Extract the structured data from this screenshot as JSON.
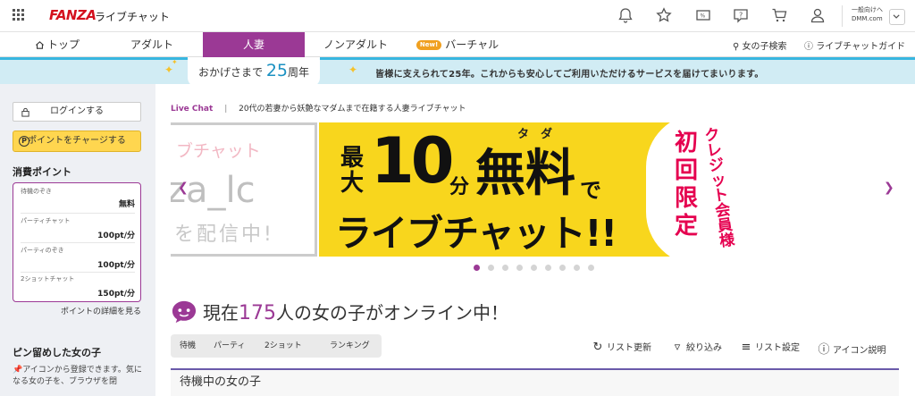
{
  "header": {
    "brand": "FANZA",
    "brand_sub": "ライブチャット",
    "adult_switch": [
      "一般向けへ",
      "DMM.com"
    ]
  },
  "nav": {
    "tabs": [
      {
        "label": "トップ"
      },
      {
        "label": "アダルト"
      },
      {
        "label": "人妻"
      },
      {
        "label": "ノンアダルト"
      },
      {
        "label": "バーチャル",
        "badge": "New!"
      }
    ],
    "right": [
      "女の子検索",
      "ライブチャットガイド"
    ]
  },
  "anniversary": {
    "pre": "おかげさまで",
    "years": "25",
    "post": "周年",
    "message": "皆様に支えられて25年。これからも安心してご利用いただけるサービスを届けてまいります。"
  },
  "sidebar": {
    "login": "ログインする",
    "charge": "ポイントをチャージする",
    "points_title": "消費ポイント",
    "points": [
      {
        "label": "待機のぞき",
        "value": "無料"
      },
      {
        "label": "パーティチャット",
        "value": "100pt/分"
      },
      {
        "label": "パーティのぞき",
        "value": "100pt/分"
      },
      {
        "label": "2ショットチャット",
        "value": "150pt/分"
      }
    ],
    "detail": "ポイントの詳細を見る",
    "pinned_title": "ピン留めした女の子",
    "pinned_note": "アイコンから登録できます。気になる女の子を、ブラウザを閉"
  },
  "main": {
    "breadcrumb_label": "Live Chat",
    "breadcrumb_sep": "|",
    "breadcrumb_desc": "20代の若妻から妖艶なマダムまで在籍する人妻ライブチャット",
    "banner": {
      "prev_lines": [
        "ブチャット",
        "za_lc",
        "を配信中!"
      ],
      "ruby": "タ　ダ",
      "line1_small": "最大",
      "line1_big": "10",
      "line1_unit": "分",
      "line1_word": "無料",
      "line1_de": "で",
      "line2": "ライブチャット!!",
      "badge_title": "初回限定",
      "badge_sub": "クレジット会員様"
    },
    "carousel_dots": 9,
    "online_pre": "現在",
    "online_count": "175",
    "online_post": "人の女の子がオンライン中！",
    "filter_tabs": [
      "待機",
      "パーティ",
      "2ショット",
      "ランキング"
    ],
    "tools": [
      "リスト更新",
      "絞り込み",
      "リスト設定",
      "アイコン説明"
    ],
    "list_heading": "待機中の女の子"
  },
  "colors": {
    "accent": "#9b3995",
    "cyan": "#38b6e0",
    "yellow": "#f8d61d",
    "red": "#e5004f"
  }
}
